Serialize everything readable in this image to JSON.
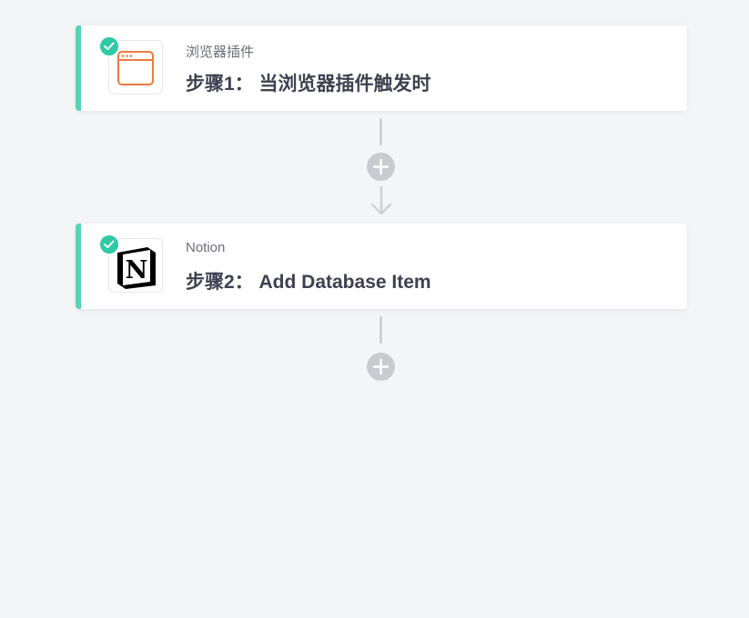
{
  "steps": [
    {
      "app_name": "浏览器插件",
      "title": "步骤1： 当浏览器插件触发时",
      "icon": "browser-window-icon",
      "status": "completed"
    },
    {
      "app_name": "Notion",
      "title": "步骤2： Add Database Item",
      "icon": "notion-logo",
      "status": "completed"
    }
  ],
  "colors": {
    "accent": "#57d3b5",
    "check_badge": "#2fc9a5",
    "browser_icon": "#ee7a3c",
    "add_button": "#c9cbd1",
    "background": "#f4f5f7"
  },
  "add_step_buttons": [
    {
      "icon": "plus-icon"
    },
    {
      "icon": "plus-icon"
    }
  ]
}
